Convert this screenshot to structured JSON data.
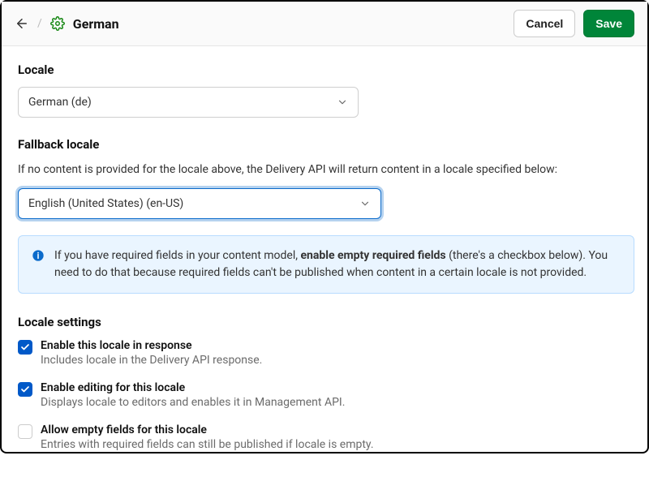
{
  "header": {
    "title": "German",
    "cancel_label": "Cancel",
    "save_label": "Save"
  },
  "locale": {
    "section_title": "Locale",
    "selected": "German (de)"
  },
  "fallback": {
    "section_title": "Fallback locale",
    "description": "If no content is provided for the locale above, the Delivery API will return content in a locale specified below:",
    "selected": "English (United States) (en-US)"
  },
  "info": {
    "text_before": "If you have required fields in your content model, ",
    "text_strong": "enable empty required fields",
    "text_after": " (there's a checkbox below). You need to do that because required fields can't be published when content in a certain locale is not provided."
  },
  "settings": {
    "section_title": "Locale settings",
    "items": [
      {
        "label": "Enable this locale in response",
        "description": "Includes locale in the Delivery API response.",
        "checked": true
      },
      {
        "label": "Enable editing for this locale",
        "description": "Displays locale to editors and enables it in Management API.",
        "checked": true
      },
      {
        "label": "Allow empty fields for this locale",
        "description": "Entries with required fields can still be published if locale is empty.",
        "checked": false
      }
    ]
  }
}
